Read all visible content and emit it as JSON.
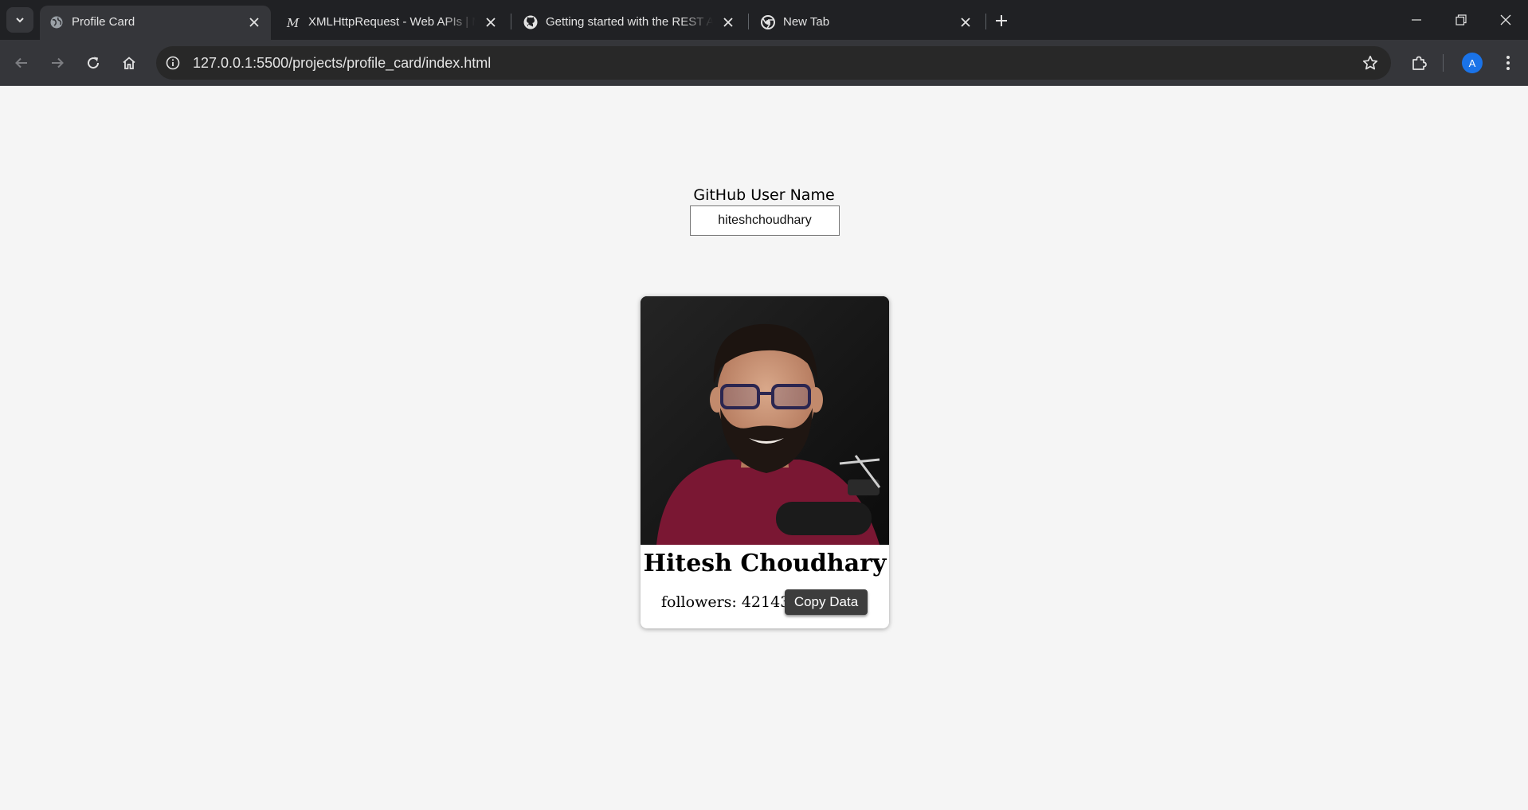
{
  "browser": {
    "tabs": [
      {
        "title": "Profile Card",
        "favicon": "globe-icon",
        "active": true
      },
      {
        "title": "XMLHttpRequest - Web APIs | MDN",
        "favicon": "mdn-icon",
        "active": false
      },
      {
        "title": "Getting started with the REST API",
        "favicon": "github-icon",
        "active": false
      },
      {
        "title": "New Tab",
        "favicon": "chrome-icon",
        "active": false
      }
    ],
    "url": "127.0.0.1:5500/projects/profile_card/index.html",
    "profile_initial": "A",
    "colors": {
      "frame": "#202124",
      "toolbar": "#35363a",
      "omnibox": "#282828",
      "avatar": "#1a73e8"
    }
  },
  "page": {
    "form_label": "GitHub User Name",
    "username_value": "hiteshchoudhary",
    "card": {
      "name": "Hitesh Choudhary",
      "followers_text": "followers: 42143",
      "copy_button_label": "Copy Data",
      "avatar_alt": "profile photo"
    },
    "colors": {
      "background": "#f5f5f5",
      "button": "#3d3d3d"
    }
  }
}
